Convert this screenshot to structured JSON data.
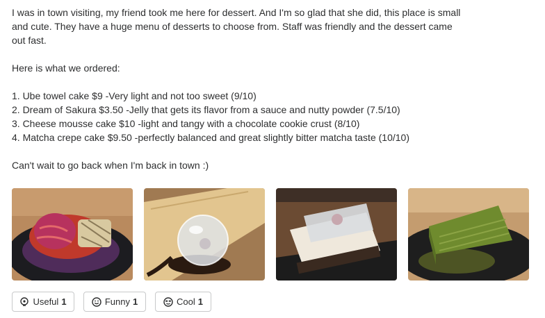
{
  "review": {
    "paragraph1": "I was in town visiting, my friend took me here for dessert. And I'm so glad that she did, this place is small and cute. They have a huge menu of desserts to choose from. Staff was friendly and the dessert came out fast.",
    "paragraph2": "Here is what we ordered:",
    "items": [
      "1. Ube towel cake $9 -Very light and not too sweet (9/10)",
      "2. Dream of Sakura $3.50 -Jelly that gets its flavor from a sauce and nutty powder (7.5/10)",
      "3. Cheese mousse cake $10 -light and tangy with a chocolate cookie crust (8/10)",
      "4. Matcha crepe cake $9.50 -perfectly balanced and great slightly bitter matcha taste (10/10)"
    ],
    "closing": "Can't wait to go back when I'm back in town :)"
  },
  "photos": [
    {
      "icon": "ube-towel-cake-photo"
    },
    {
      "icon": "dream-of-sakura-photo"
    },
    {
      "icon": "cheese-mousse-cake-photo"
    },
    {
      "icon": "matcha-crepe-cake-photo"
    }
  ],
  "reactions": {
    "useful": {
      "label": "Useful",
      "count": "1"
    },
    "funny": {
      "label": "Funny",
      "count": "1"
    },
    "cool": {
      "label": "Cool",
      "count": "1"
    }
  }
}
